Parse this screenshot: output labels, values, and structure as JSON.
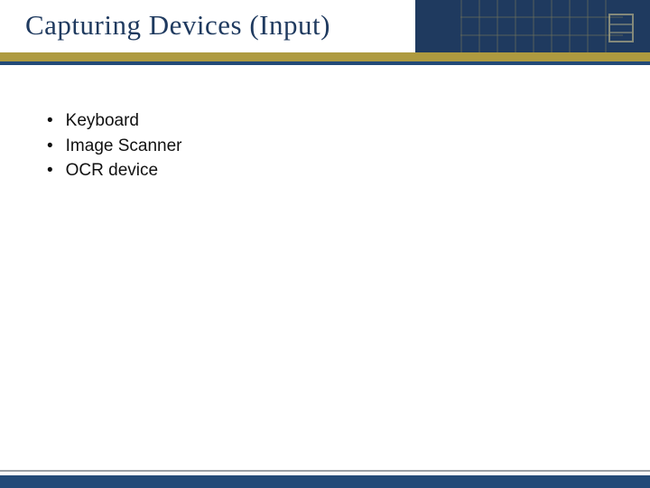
{
  "slide": {
    "title": "Capturing Devices (Input)",
    "bullets": [
      "Keyboard",
      "Image Scanner",
      "OCR device"
    ]
  }
}
